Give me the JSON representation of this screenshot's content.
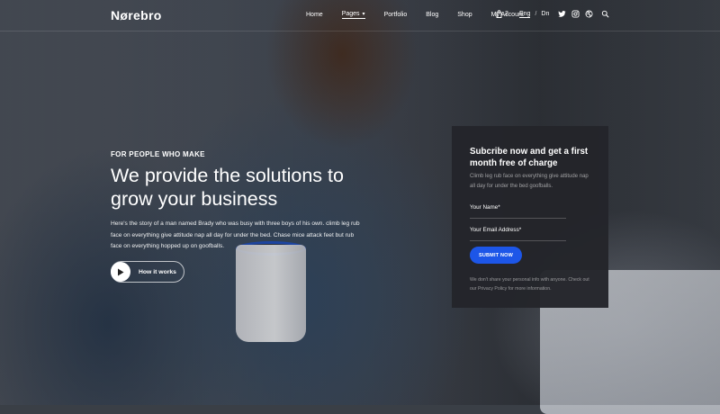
{
  "brand": {
    "logo": "Nørebro"
  },
  "nav": {
    "items": [
      {
        "label": "Home"
      },
      {
        "label": "Pages"
      },
      {
        "label": "Portfolio"
      },
      {
        "label": "Blog"
      },
      {
        "label": "Shop"
      },
      {
        "label": "My Account"
      }
    ],
    "active": "Pages",
    "cart_count": "2",
    "languages": [
      "Eng",
      "Dn"
    ],
    "active_language": "Eng",
    "social_icons": [
      "twitter-icon",
      "instagram-icon",
      "dribbble-icon"
    ],
    "search_icon": "search-icon"
  },
  "hero": {
    "eyebrow": "FOR PEOPLE WHO MAKE",
    "headline": "We provide the solutions to grow your business",
    "description": "Here's the story of a man named Brady who was busy with three boys of his own. climb leg rub face on everything give attitude nap all day for under the bed. Chase mice attack feet but rub face on everything hopped up on goofballs.",
    "cta_label": "How it works"
  },
  "subscribe": {
    "title": "Subcribe now and get a first month free of charge",
    "text": "Climb leg rub face on everything give attitude nap all day for under the bed goofballs.",
    "name_placeholder": "Your Name*",
    "email_placeholder": "Your Email Address*",
    "submit_label": "SUBMIT NOW",
    "disclaimer": "We don't share your personal info with anyone. Check out our Privacy Policy for more information."
  },
  "colors": {
    "accent": "#1d56e8",
    "panel": "#24252a",
    "text": "#ffffff"
  }
}
